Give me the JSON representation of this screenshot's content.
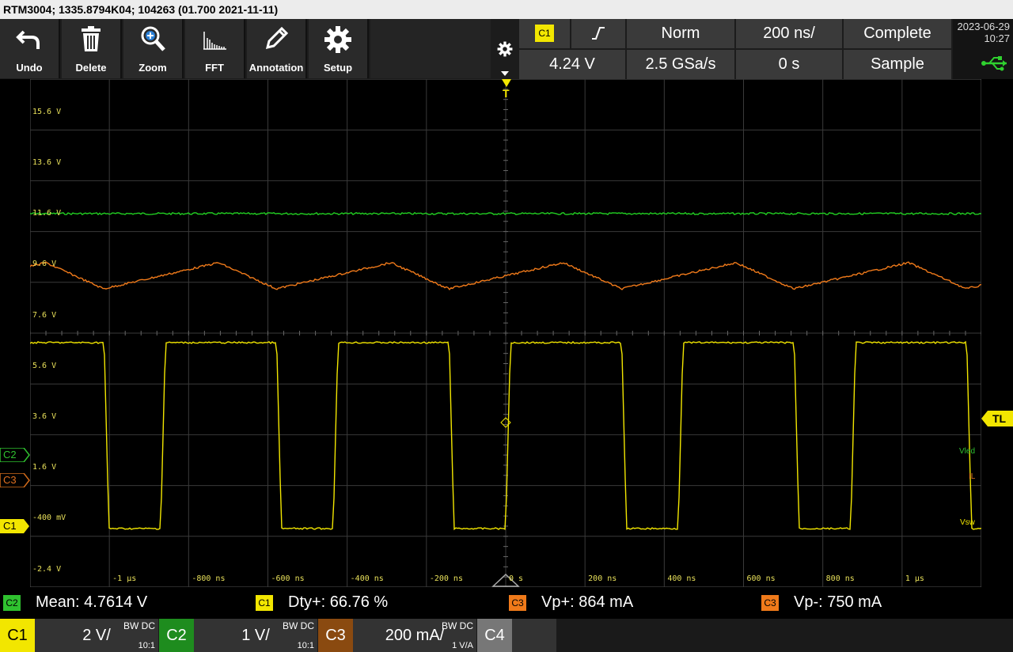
{
  "window": {
    "title": "RTM3004; 1335.8794K04; 104263 (01.700 2021-11-11)"
  },
  "toolbar": {
    "buttons": [
      {
        "label": "Undo",
        "icon": "undo-icon"
      },
      {
        "label": "Delete",
        "icon": "trash-icon"
      },
      {
        "label": "Zoom",
        "icon": "zoom-icon"
      },
      {
        "label": "FFT",
        "icon": "fft-icon"
      },
      {
        "label": "Annotation",
        "icon": "pencil-icon"
      },
      {
        "label": "Setup",
        "icon": "gear-icon"
      }
    ]
  },
  "trigger": {
    "source": "C1",
    "slope_icon": "rising-edge-icon",
    "mode": "Norm",
    "timebase": "200 ns/",
    "acq_state": "Complete",
    "level": "4.24 V",
    "sample_rate": "2.5 GSa/s",
    "position": "0 s",
    "acq_mode": "Sample"
  },
  "clock": {
    "date": "2023-06-29",
    "time": "10:27"
  },
  "y_labels": [
    "15.6 V",
    "13.6 V",
    "11.6 V",
    "9.6 V",
    "7.6 V",
    "5.6 V",
    "3.6 V",
    "1.6 V",
    "-400 mV",
    "-2.4 V"
  ],
  "x_labels": [
    "-1 µs",
    "-800 ns",
    "-600 ns",
    "-400 ns",
    "-200 ns",
    "0 s",
    "200 ns",
    "400 ns",
    "600 ns",
    "800 ns",
    "1 µs"
  ],
  "markers": {
    "c2": "C2",
    "c3": "C3",
    "c1": "C1",
    "trigger_level": "TL",
    "trigger_pos": "T"
  },
  "signal_labels": {
    "c2": "Vled",
    "c3": "IL",
    "c1": "Vsw"
  },
  "measurements": [
    {
      "src": "C2",
      "text": "Mean: 4.7614 V",
      "color": "#2fc12f"
    },
    {
      "src": "C1",
      "text": "Dty+: 66.76 %",
      "color": "#f2e600"
    },
    {
      "src": "C3",
      "text": "Vp+: 864 mA",
      "color": "#f07a1a"
    },
    {
      "src": "C3",
      "text": "Vp-: 750 mA",
      "color": "#f07a1a"
    }
  ],
  "channels": [
    {
      "name": "C1",
      "scale": "2 V/",
      "bw": "BW DC",
      "probe": "10:1",
      "color": "#f2e600",
      "textcolor": "#000"
    },
    {
      "name": "C2",
      "scale": "1 V/",
      "bw": "BW DC",
      "probe": "10:1",
      "color": "#1e8c1e",
      "textcolor": "#fff"
    },
    {
      "name": "C3",
      "scale": "200 mA/",
      "bw": "BW DC",
      "probe": "1 V/A",
      "color": "#8a4a10",
      "textcolor": "#fff"
    },
    {
      "name": "C4",
      "scale": "",
      "bw": "",
      "probe": "",
      "color": "#777777",
      "textcolor": "#fff"
    }
  ],
  "colors": {
    "c1": "#f2e600",
    "c2": "#22d022",
    "c3": "#f07a1a",
    "grid": "#3a3a3a"
  }
}
